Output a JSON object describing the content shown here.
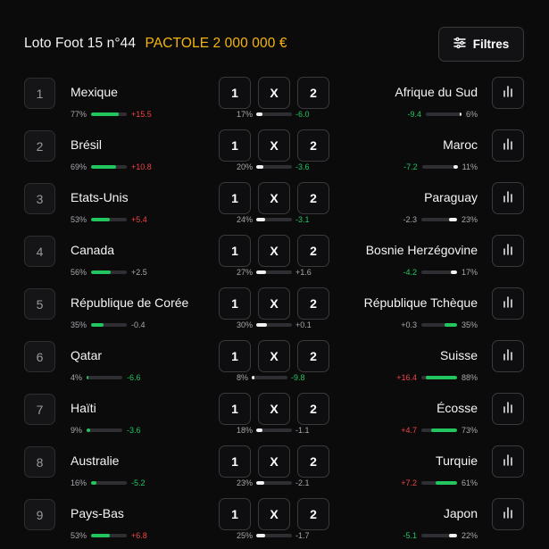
{
  "header": {
    "title": "Loto Foot 15 n°44",
    "jackpot": "PACTOLE 2 000 000 €",
    "filters_label": "Filtres",
    "filters_icon": "sliders-icon"
  },
  "colors": {
    "accent": "#f5b50b",
    "positive": "#22c55e",
    "negative": "#ef4444",
    "background": "#0b0b0c"
  },
  "picks": {
    "home": "1",
    "draw": "X",
    "away": "2"
  },
  "matches": [
    {
      "number": "1",
      "home": "Mexique",
      "home_pct": "77%",
      "home_fill": 0.77,
      "home_delta": "+15.5",
      "home_delta_color": "red",
      "draw_pct": "17%",
      "draw_fill": 0.17,
      "draw_delta": "-6.0",
      "draw_delta_color": "green",
      "away": "Afrique du Sud",
      "away_pct": "6%",
      "away_fill": 0.06,
      "away_delta": "-9.4",
      "away_delta_color": "green",
      "away_bar": "white"
    },
    {
      "number": "2",
      "home": "Brésil",
      "home_pct": "69%",
      "home_fill": 0.69,
      "home_delta": "+10.8",
      "home_delta_color": "red",
      "draw_pct": "20%",
      "draw_fill": 0.2,
      "draw_delta": "-3.6",
      "draw_delta_color": "green",
      "away": "Maroc",
      "away_pct": "11%",
      "away_fill": 0.11,
      "away_delta": "-7.2",
      "away_delta_color": "green",
      "away_bar": "white"
    },
    {
      "number": "3",
      "home": "Etats-Unis",
      "home_pct": "53%",
      "home_fill": 0.53,
      "home_delta": "+5.4",
      "home_delta_color": "red",
      "draw_pct": "24%",
      "draw_fill": 0.24,
      "draw_delta": "-3.1",
      "draw_delta_color": "green",
      "away": "Paraguay",
      "away_pct": "23%",
      "away_fill": 0.23,
      "away_delta": "-2.3",
      "away_delta_color": "grey",
      "away_bar": "white"
    },
    {
      "number": "4",
      "home": "Canada",
      "home_pct": "56%",
      "home_fill": 0.56,
      "home_delta": "+2.5",
      "home_delta_color": "grey",
      "draw_pct": "27%",
      "draw_fill": 0.27,
      "draw_delta": "+1.6",
      "draw_delta_color": "grey",
      "away": "Bosnie Herzégovine",
      "away_pct": "17%",
      "away_fill": 0.17,
      "away_delta": "-4.2",
      "away_delta_color": "green",
      "away_bar": "white"
    },
    {
      "number": "5",
      "home": "République de Corée",
      "home_pct": "35%",
      "home_fill": 0.35,
      "home_delta": "-0.4",
      "home_delta_color": "grey",
      "draw_pct": "30%",
      "draw_fill": 0.3,
      "draw_delta": "+0.1",
      "draw_delta_color": "grey",
      "away": "République Tchèque",
      "away_pct": "35%",
      "away_fill": 0.35,
      "away_delta": "+0.3",
      "away_delta_color": "grey",
      "away_bar": "green"
    },
    {
      "number": "6",
      "home": "Qatar",
      "home_pct": "4%",
      "home_fill": 0.04,
      "home_delta": "-6.6",
      "home_delta_color": "green",
      "draw_pct": "8%",
      "draw_fill": 0.08,
      "draw_delta": "-9.8",
      "draw_delta_color": "green",
      "away": "Suisse",
      "away_pct": "88%",
      "away_fill": 0.88,
      "away_delta": "+16.4",
      "away_delta_color": "red",
      "away_bar": "green"
    },
    {
      "number": "7",
      "home": "Haïti",
      "home_pct": "9%",
      "home_fill": 0.09,
      "home_delta": "-3.6",
      "home_delta_color": "green",
      "draw_pct": "18%",
      "draw_fill": 0.18,
      "draw_delta": "-1.1",
      "draw_delta_color": "grey",
      "away": "Écosse",
      "away_pct": "73%",
      "away_fill": 0.73,
      "away_delta": "+4.7",
      "away_delta_color": "red",
      "away_bar": "green"
    },
    {
      "number": "8",
      "home": "Australie",
      "home_pct": "16%",
      "home_fill": 0.16,
      "home_delta": "-5.2",
      "home_delta_color": "green",
      "draw_pct": "23%",
      "draw_fill": 0.23,
      "draw_delta": "-2.1",
      "draw_delta_color": "grey",
      "away": "Turquie",
      "away_pct": "61%",
      "away_fill": 0.61,
      "away_delta": "+7.2",
      "away_delta_color": "red",
      "away_bar": "green"
    },
    {
      "number": "9",
      "home": "Pays-Bas",
      "home_pct": "53%",
      "home_fill": 0.53,
      "home_delta": "+6.8",
      "home_delta_color": "red",
      "draw_pct": "25%",
      "draw_fill": 0.25,
      "draw_delta": "-1.7",
      "draw_delta_color": "grey",
      "away": "Japon",
      "away_pct": "22%",
      "away_fill": 0.22,
      "away_delta": "-5.1",
      "away_delta_color": "green",
      "away_bar": "white"
    }
  ],
  "row_icons": {
    "stats": "bar-chart-icon"
  }
}
